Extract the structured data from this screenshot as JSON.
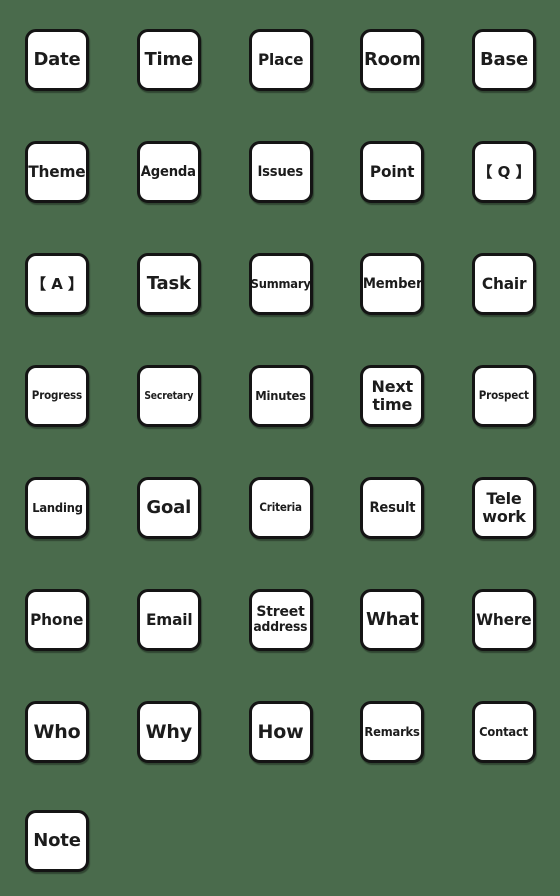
{
  "sheet": {
    "title": "Meeting notes label emoji sheet",
    "background_color": "#4a6b4c",
    "tile_fill_color": "#ffffff",
    "tile_border_color": "#141414",
    "text_color": "#1c1c1c",
    "columns": 5,
    "rows": 8,
    "tile_count": 36
  },
  "tiles": [
    {
      "id": "date",
      "label": "Date",
      "lines": [
        "Date"
      ],
      "row": 1,
      "col": 1
    },
    {
      "id": "time",
      "label": "Time",
      "lines": [
        "Time"
      ],
      "row": 1,
      "col": 2
    },
    {
      "id": "place",
      "label": "Place",
      "lines": [
        "Place"
      ],
      "row": 1,
      "col": 3
    },
    {
      "id": "room",
      "label": "Room",
      "lines": [
        "Room"
      ],
      "row": 1,
      "col": 4
    },
    {
      "id": "base",
      "label": "Base",
      "lines": [
        "Base"
      ],
      "row": 1,
      "col": 5
    },
    {
      "id": "theme",
      "label": "Theme",
      "lines": [
        "Theme"
      ],
      "row": 2,
      "col": 1
    },
    {
      "id": "agenda",
      "label": "Agenda",
      "lines": [
        "Agenda"
      ],
      "row": 2,
      "col": 2
    },
    {
      "id": "issues",
      "label": "Issues",
      "lines": [
        "Issues"
      ],
      "row": 2,
      "col": 3
    },
    {
      "id": "point",
      "label": "Point",
      "lines": [
        "Point"
      ],
      "row": 2,
      "col": 4
    },
    {
      "id": "question",
      "label": "【 Q 】",
      "lines": [
        "【 Q 】"
      ],
      "row": 2,
      "col": 5
    },
    {
      "id": "answer",
      "label": "【 A 】",
      "lines": [
        "【 A 】"
      ],
      "row": 3,
      "col": 1
    },
    {
      "id": "task",
      "label": "Task",
      "lines": [
        "Task"
      ],
      "row": 3,
      "col": 2
    },
    {
      "id": "summary",
      "label": "Summary",
      "lines": [
        "Summary"
      ],
      "row": 3,
      "col": 3
    },
    {
      "id": "member",
      "label": "Member",
      "lines": [
        "Member"
      ],
      "row": 3,
      "col": 4
    },
    {
      "id": "chair",
      "label": "Chair",
      "lines": [
        "Chair"
      ],
      "row": 3,
      "col": 5
    },
    {
      "id": "progress",
      "label": "Progress",
      "lines": [
        "Progress"
      ],
      "row": 4,
      "col": 1
    },
    {
      "id": "secretary",
      "label": "Secretary",
      "lines": [
        "Secretary"
      ],
      "row": 4,
      "col": 2
    },
    {
      "id": "minutes",
      "label": "Minutes",
      "lines": [
        "Minutes"
      ],
      "row": 4,
      "col": 3
    },
    {
      "id": "next-time",
      "label": "Next time",
      "lines": [
        "Next",
        "time"
      ],
      "row": 4,
      "col": 4
    },
    {
      "id": "prospect",
      "label": "Prospect",
      "lines": [
        "Prospect"
      ],
      "row": 4,
      "col": 5
    },
    {
      "id": "landing",
      "label": "Landing",
      "lines": [
        "Landing"
      ],
      "row": 5,
      "col": 1
    },
    {
      "id": "goal",
      "label": "Goal",
      "lines": [
        "Goal"
      ],
      "row": 5,
      "col": 2
    },
    {
      "id": "criteria",
      "label": "Criteria",
      "lines": [
        "Criteria"
      ],
      "row": 5,
      "col": 3
    },
    {
      "id": "result",
      "label": "Result",
      "lines": [
        "Result"
      ],
      "row": 5,
      "col": 4
    },
    {
      "id": "telework",
      "label": "Tele work",
      "lines": [
        "Tele",
        "work"
      ],
      "row": 5,
      "col": 5
    },
    {
      "id": "phone",
      "label": "Phone",
      "lines": [
        "Phone"
      ],
      "row": 6,
      "col": 1
    },
    {
      "id": "email",
      "label": "Email",
      "lines": [
        "Email"
      ],
      "row": 6,
      "col": 2
    },
    {
      "id": "street-address",
      "label": "Street address",
      "lines": [
        "Street",
        "address"
      ],
      "row": 6,
      "col": 3
    },
    {
      "id": "what",
      "label": "What",
      "lines": [
        "What"
      ],
      "row": 6,
      "col": 4
    },
    {
      "id": "where",
      "label": "Where",
      "lines": [
        "Where"
      ],
      "row": 6,
      "col": 5
    },
    {
      "id": "who",
      "label": "Who",
      "lines": [
        "Who"
      ],
      "row": 7,
      "col": 1
    },
    {
      "id": "why",
      "label": "Why",
      "lines": [
        "Why"
      ],
      "row": 7,
      "col": 2
    },
    {
      "id": "how",
      "label": "How",
      "lines": [
        "How"
      ],
      "row": 7,
      "col": 3
    },
    {
      "id": "remarks",
      "label": "Remarks",
      "lines": [
        "Remarks"
      ],
      "row": 7,
      "col": 4
    },
    {
      "id": "contact",
      "label": "Contact",
      "lines": [
        "Contact"
      ],
      "row": 7,
      "col": 5
    },
    {
      "id": "note",
      "label": "Note",
      "lines": [
        "Note"
      ],
      "row": 8,
      "col": 1
    }
  ]
}
